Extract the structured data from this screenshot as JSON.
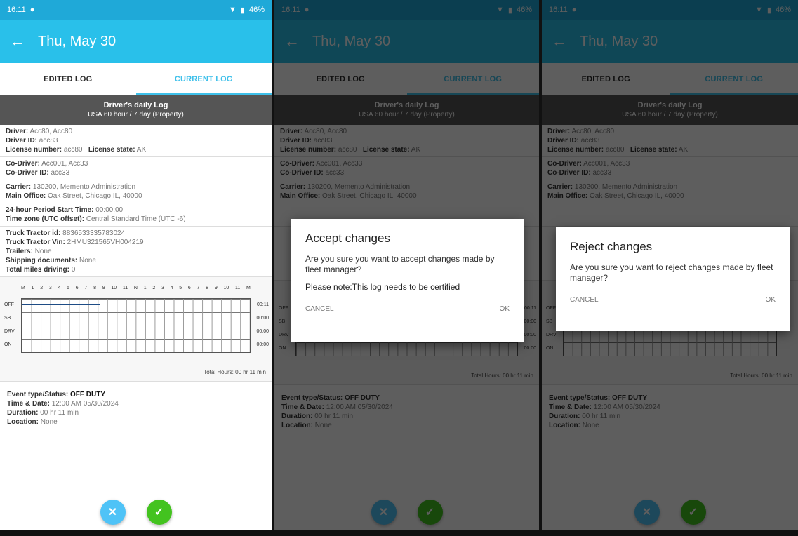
{
  "status": {
    "time": "16:11",
    "battery": "46%"
  },
  "header": {
    "title": "Thu, May 30"
  },
  "tabs": [
    "EDITED LOG",
    "CURRENT LOG"
  ],
  "banner": {
    "line1": "Driver's daily Log",
    "line2": "USA 60 hour / 7 day (Property)"
  },
  "driver": {
    "driver_label": "Driver:",
    "driver_value": "Acc80, Acc80",
    "driver_id_label": "Driver ID:",
    "driver_id_value": "acc83",
    "license_label": "License number:",
    "license_value": "acc80",
    "license_state_label": "License state:",
    "license_state_value": "AK"
  },
  "codriver": {
    "label": "Co-Driver:",
    "value": "Acc001, Acc33",
    "id_label": "Co-Driver ID:",
    "id_value": "acc33"
  },
  "carrier": {
    "label": "Carrier:",
    "value": "130200, Memento Administration",
    "office_label": "Main Office:",
    "office_value": "Oak Street, Chicago IL, 40000"
  },
  "period": {
    "start_label": "24-hour Period Start Time:",
    "start_value": "00:00:00",
    "tz_label": "Time zone (UTC offset):",
    "tz_value": "Central Standard Time (UTC -6)"
  },
  "truck": {
    "tracker_label": "Truck Tractor id:",
    "tracker_value": "8836533335783024",
    "vin_label": "Truck Tractor Vin:",
    "vin_value": "2HMU321565VH004219",
    "trailers_label": "Trailers:",
    "trailers_value": "None",
    "shipping_label": "Shipping documents:",
    "shipping_value": "None",
    "miles_label": "Total miles driving:",
    "miles_value": "0"
  },
  "grid": {
    "hour_labels": [
      "M",
      "1",
      "2",
      "3",
      "4",
      "5",
      "6",
      "7",
      "8",
      "9",
      "10",
      "11",
      "N",
      "1",
      "2",
      "3",
      "4",
      "5",
      "6",
      "7",
      "8",
      "9",
      "10",
      "11",
      "M"
    ],
    "left_labels": [
      "OFF",
      "SB",
      "DRV",
      "ON"
    ],
    "right_labels": [
      "00:11",
      "00:00",
      "00:00",
      "00:00"
    ],
    "total": "Total Hours: 00 hr 11 min"
  },
  "event": {
    "type_label": "Event type/Status:",
    "type_value": "OFF DUTY",
    "time_label": "Time & Date:",
    "time_value": "12:00 AM 05/30/2024",
    "duration_label": "Duration:",
    "duration_value": "00 hr 11 min",
    "location_label": "Location:",
    "location_value": "None"
  },
  "accept_dialog": {
    "title": "Accept changes",
    "body": "Are you sure you want to accept changes made by fleet manager?",
    "note": "Please note:This log needs to be certified",
    "cancel": "CANCEL",
    "ok": "OK"
  },
  "reject_dialog": {
    "title": "Reject changes",
    "body": "Are you sure you want to reject changes made by fleet manager?",
    "cancel": "CANCEL",
    "ok": "OK"
  },
  "colors": {
    "appbar": "#29c0ea",
    "status": "#1fa9d8",
    "accent": "#3ec0ea",
    "accept": "#43c31f"
  }
}
